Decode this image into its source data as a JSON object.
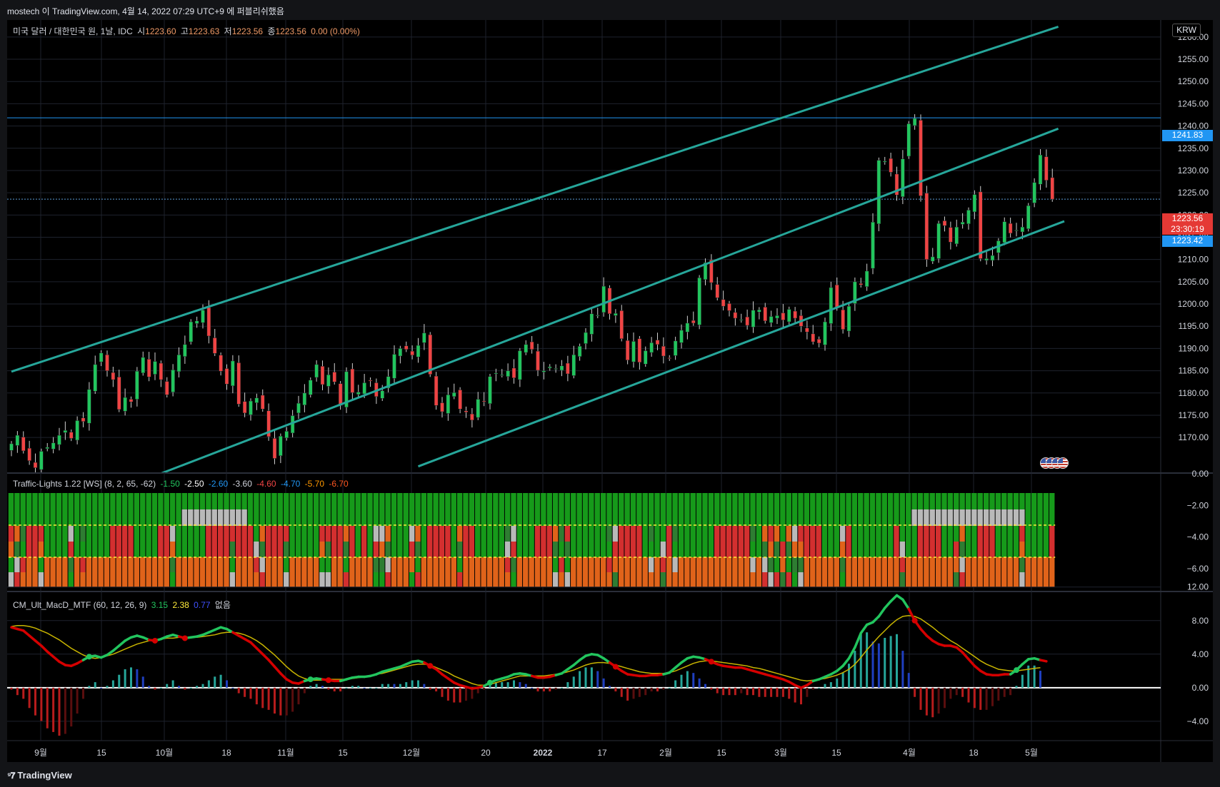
{
  "header": {
    "publish_text": "mostech 이 TradingView.com, 4월 14, 2022 07:29 UTC+9 에 퍼블리쉬했음"
  },
  "symbol_legend": {
    "title": "미국 달러 / 대한민국 원, 1날, IDC",
    "open_label": "시",
    "open_value": "1223.60",
    "high_label": "고",
    "high_value": "1223.63",
    "low_label": "저",
    "low_value": "1223.56",
    "close_label": "종",
    "close_value": "1223.56",
    "change": "0.00 (0.00%)"
  },
  "traffic_legend": {
    "title": "Traffic-Lights 1.22 [WS] (8, 2, 65, -62)",
    "values": [
      {
        "text": "-1.50",
        "color": "#22c55e"
      },
      {
        "text": "-2.50",
        "color": "#ffffff"
      },
      {
        "text": "-2.60",
        "color": "#2196f3"
      },
      {
        "text": "-3.60",
        "color": "#d1d4dc"
      },
      {
        "text": "-4.60",
        "color": "#ef4444"
      },
      {
        "text": "-4.70",
        "color": "#2196f3"
      },
      {
        "text": "-5.70",
        "color": "#ff9800"
      },
      {
        "text": "-6.70",
        "color": "#ff5722"
      }
    ]
  },
  "macd_legend": {
    "title": "CM_Ult_MacD_MTF (60, 12, 26, 9)",
    "v1": "3.15",
    "v1_color": "#22c55e",
    "v2": "2.38",
    "v2_color": "#ffeb3b",
    "v3": "0.77",
    "v3_color": "#3f51ff",
    "v4": "없음"
  },
  "currency_button": "KRW",
  "price_badges": {
    "line1": "1241.83",
    "line2_price": "1223.56",
    "line2_countdown": "23:30:19",
    "line3": "1223.42"
  },
  "colors": {
    "up": "#22c55e",
    "down": "#ef4444",
    "channel": "#26a69a",
    "macd_signal": "#c8b400",
    "hist_pos": "#26a69a",
    "hist_neg": "#b71c1c",
    "badge_blue": "#2196f3",
    "badge_red": "#e53935"
  },
  "footer": {
    "brand": "TradingView",
    "logo_icon": "tradingview-logo-icon"
  },
  "chart_data": [
    {
      "type": "candlestick",
      "title": "미국 달러 / 대한민국 원, 1날, IDC",
      "x_tick_labels": [
        "9월",
        "15",
        "10월",
        "18",
        "11월",
        "15",
        "12월",
        "20",
        "2022",
        "17",
        "2월",
        "15",
        "3월",
        "15",
        "4월",
        "18",
        "5월"
      ],
      "y_ticks": [
        1170,
        1175,
        1180,
        1185,
        1190,
        1195,
        1200,
        1205,
        1210,
        1215,
        1220,
        1225,
        1230,
        1235,
        1240,
        1245,
        1250,
        1255,
        1260
      ],
      "y_tick_format": "0.00",
      "ylim": [
        1166.5,
        1263.5
      ],
      "horizontal_lines": [
        1241.83,
        1223.56
      ],
      "last_close": 1223.56,
      "channel_lines": [
        {
          "name": "upper",
          "start": [
            0,
            1184.8
          ],
          "end": [
            175,
            1262.3
          ]
        },
        {
          "name": "middle",
          "start": [
            0,
            1149.0
          ],
          "end": [
            175,
            1239.4
          ]
        },
        {
          "name": "lower",
          "start": [
            68,
            1163.5
          ],
          "end": [
            176,
            1218.6
          ]
        }
      ],
      "series_ohlc_note": "daily candles, index 0 = Sep 1 2021",
      "closes": [
        1168.6,
        1170.5,
        1167.0,
        1164.8,
        1163.2,
        1166.9,
        1167.8,
        1168.8,
        1170.5,
        1171.6,
        1169.8,
        1173.8,
        1173.6,
        1180.8,
        1186.4,
        1189.0,
        1185.0,
        1183.0,
        1176.3,
        1179.0,
        1178.0,
        1184.9,
        1188.0,
        1183.6,
        1187.1,
        1183.0,
        1179.6,
        1185.2,
        1188.6,
        1190.9,
        1196.0,
        1196.2,
        1198.6,
        1192.8,
        1188.9,
        1184.9,
        1182.0,
        1187.2,
        1177.5,
        1175.5,
        1178.2,
        1178.9,
        1176.4,
        1170.2,
        1165.3,
        1170.3,
        1171.4,
        1174.9,
        1177.7,
        1180.0,
        1182.9,
        1186.4,
        1181.9,
        1184.1,
        1182.5,
        1177.2,
        1184.8,
        1180.1,
        1180.2,
        1182.3,
        1182.7,
        1179.2,
        1180.5,
        1183.7,
        1188.7,
        1190.0,
        1189.8,
        1188.5,
        1190.7,
        1193.5,
        1184.2,
        1177.2,
        1175.8,
        1179.6,
        1180.1,
        1176.4,
        1175.7,
        1173.9,
        1178.6,
        1178.0,
        1183.7,
        1184.5,
        1184.1,
        1185.0,
        1183.4,
        1189.5,
        1190.9,
        1189.8,
        1185.1,
        1185.0,
        1185.9,
        1185.5,
        1186.1,
        1184.3,
        1188.6,
        1190.5,
        1193.6,
        1197.8,
        1197.5,
        1204.0,
        1197.8,
        1197.9,
        1192.2,
        1187.4,
        1191.6,
        1186.9,
        1189.5,
        1191.3,
        1190.9,
        1188.3,
        1187.8,
        1191.7,
        1194.1,
        1195.7,
        1195.7,
        1205.9,
        1209.3,
        1204.8,
        1201.4,
        1199.5,
        1198.5,
        1196.8,
        1196.5,
        1195.2,
        1198.6,
        1198.7,
        1196.2,
        1197.2,
        1197.4,
        1196.4,
        1198.8,
        1196.8,
        1195.0,
        1193.7,
        1191.5,
        1191.2,
        1196.0,
        1203.7,
        1199.1,
        1194.3,
        1199.5,
        1205.0,
        1204.3,
        1207.4,
        1218.4,
        1232.3,
        1232.1,
        1229.6,
        1224.5,
        1232.6,
        1240.5,
        1241.7,
        1224.3,
        1210.0,
        1210.6,
        1218.1,
        1217.6,
        1213.9,
        1217.3,
        1218.4,
        1221.1,
        1224.6,
        1210.2,
        1210.2,
        1210.9,
        1214.2,
        1218.5,
        1215.9,
        1216.6,
        1217.3,
        1222.1,
        1227.3,
        1233.5,
        1227.8,
        1223.56
      ]
    },
    {
      "type": "heatmap",
      "title": "Traffic-Lights 1.22 [WS] (8, 2, 65, -62)",
      "y_ticks": [
        "0.00",
        "−2.00",
        "−4.00",
        "−6.00"
      ],
      "rows": 6,
      "note": "columns aligned with candles; row cells colored green/grey/red/orange/dark-green"
    },
    {
      "type": "line",
      "title": "CM_Ult_MacD_MTF (60, 12, 26, 9)",
      "y_ticks": [
        "12.00",
        "8.00",
        "4.00",
        "0.00",
        "−4.00"
      ],
      "ylim": [
        -5.2,
        12.4
      ],
      "series": [
        {
          "name": "MACD",
          "values": [
            7.2,
            7.0,
            6.8,
            6.2,
            5.6,
            5.0,
            4.3,
            3.7,
            3.1,
            2.7,
            2.6,
            2.9,
            3.3,
            3.7,
            3.8,
            3.6,
            3.9,
            4.4,
            5.0,
            5.6,
            6.0,
            6.2,
            6.0,
            5.7,
            5.6,
            5.8,
            6.1,
            6.3,
            6.1,
            5.9,
            6.0,
            6.1,
            6.3,
            6.6,
            6.9,
            7.2,
            7.0,
            6.6,
            6.2,
            5.8,
            5.4,
            4.7,
            4.0,
            3.3,
            2.5,
            1.7,
            1.0,
            0.6,
            0.5,
            0.8,
            1.0,
            1.1,
            1.0,
            0.9,
            0.8,
            0.8,
            1.0,
            1.2,
            1.3,
            1.3,
            1.4,
            1.6,
            1.9,
            2.1,
            2.3,
            2.5,
            2.8,
            3.1,
            3.2,
            3.0,
            2.6,
            2.2,
            1.6,
            1.1,
            0.6,
            0.3,
            0.1,
            -0.1,
            0.0,
            0.2,
            0.6,
            0.9,
            1.1,
            1.3,
            1.6,
            1.7,
            1.6,
            1.4,
            1.2,
            1.2,
            1.3,
            1.5,
            1.7,
            2.2,
            2.7,
            3.3,
            3.8,
            4.0,
            3.9,
            3.5,
            3.0,
            2.5,
            2.0,
            1.6,
            1.5,
            1.4,
            1.4,
            1.5,
            1.5,
            1.6,
            1.8,
            2.4,
            3.0,
            3.5,
            3.7,
            3.6,
            3.4,
            3.1,
            2.8,
            2.6,
            2.5,
            2.4,
            2.4,
            2.2,
            2.0,
            1.8,
            1.6,
            1.4,
            1.2,
            1.0,
            0.7,
            0.3,
            0.0,
            0.3,
            0.8,
            1.0,
            1.3,
            1.6,
            2.0,
            2.6,
            3.5,
            4.8,
            6.5,
            7.5,
            7.8,
            8.5,
            9.5,
            10.3,
            11.0,
            10.5,
            9.4,
            8.0,
            7.0,
            6.2,
            5.6,
            5.2,
            5.0,
            5.0,
            4.8,
            4.2,
            3.4,
            2.6,
            2.0,
            1.6,
            1.5,
            1.5,
            1.6,
            1.6,
            2.1,
            2.8,
            3.4,
            3.5,
            3.3,
            3.15
          ]
        },
        {
          "name": "Signal",
          "values": [
            7.3,
            7.4,
            7.4,
            7.3,
            7.1,
            6.8,
            6.5,
            6.1,
            5.7,
            5.2,
            4.7,
            4.3,
            3.9,
            3.6,
            3.5,
            3.6,
            3.8,
            4.0,
            4.3,
            4.6,
            4.9,
            5.2,
            5.4,
            5.6,
            5.7,
            5.8,
            5.9,
            5.9,
            6.0,
            6.0,
            6.0,
            6.0,
            6.1,
            6.2,
            6.3,
            6.5,
            6.6,
            6.6,
            6.5,
            6.3,
            6.0,
            5.6,
            5.1,
            4.5,
            3.9,
            3.2,
            2.5,
            1.9,
            1.4,
            1.1,
            0.9,
            0.9,
            0.9,
            1.0,
            1.0,
            1.0,
            1.0,
            1.1,
            1.2,
            1.3,
            1.4,
            1.6,
            1.7,
            1.9,
            2.1,
            2.3,
            2.5,
            2.7,
            2.8,
            2.8,
            2.7,
            2.4,
            2.1,
            1.8,
            1.4,
            1.1,
            0.8,
            0.5,
            0.3,
            0.3,
            0.4,
            0.6,
            0.8,
            1.0,
            1.2,
            1.4,
            1.4,
            1.4,
            1.4,
            1.4,
            1.5,
            1.6,
            1.7,
            1.9,
            2.1,
            2.4,
            2.7,
            2.9,
            3.0,
            3.0,
            2.9,
            2.7,
            2.5,
            2.3,
            2.1,
            1.9,
            1.8,
            1.7,
            1.7,
            1.7,
            1.8,
            2.0,
            2.3,
            2.6,
            2.9,
            3.1,
            3.2,
            3.2,
            3.1,
            3.0,
            2.9,
            2.8,
            2.7,
            2.6,
            2.4,
            2.3,
            2.1,
            1.9,
            1.7,
            1.5,
            1.3,
            1.1,
            0.9,
            0.8,
            0.9,
            1.0,
            1.1,
            1.3,
            1.5,
            1.8,
            2.2,
            2.8,
            3.6,
            4.5,
            5.3,
            6.1,
            6.8,
            7.5,
            8.1,
            8.5,
            8.6,
            8.5,
            8.2,
            7.7,
            7.2,
            6.6,
            6.1,
            5.6,
            5.2,
            4.7,
            4.2,
            3.7,
            3.2,
            2.8,
            2.5,
            2.2,
            2.1,
            2.0,
            2.0,
            2.1,
            2.2,
            2.3,
            2.38
          ]
        }
      ]
    }
  ]
}
